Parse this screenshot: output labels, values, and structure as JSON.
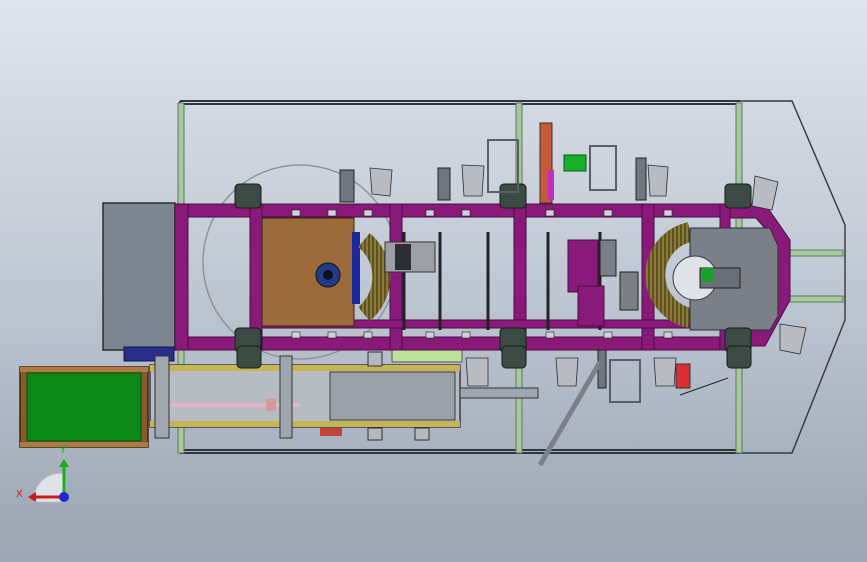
{
  "viewport": {
    "background_top": "#dfe4ec",
    "background_bottom": "#9aa4b2"
  },
  "colors": {
    "frame_purple": "#8a1a7a",
    "frame_purple_dark": "#5c0f52",
    "wood_plate": "#9a6a3a",
    "guard_green": "#0b8a1a",
    "guard_wood": "#8a5a2a",
    "motor_box": "#7d8590",
    "tie_rod_green": "#a7c7a0",
    "steel_grey": "#6a6f78",
    "gear_olive": "#8a7a3a",
    "wheel_dark": "#3c4a44",
    "axis_red": "#d01a1a",
    "axis_green": "#18b018",
    "axis_blue": "#1a2ad0"
  },
  "triad": {
    "x_label": "X",
    "y_label": "Y",
    "icons": [
      "axis-x-arrow",
      "axis-y-arrow",
      "axis-z-dot"
    ]
  }
}
